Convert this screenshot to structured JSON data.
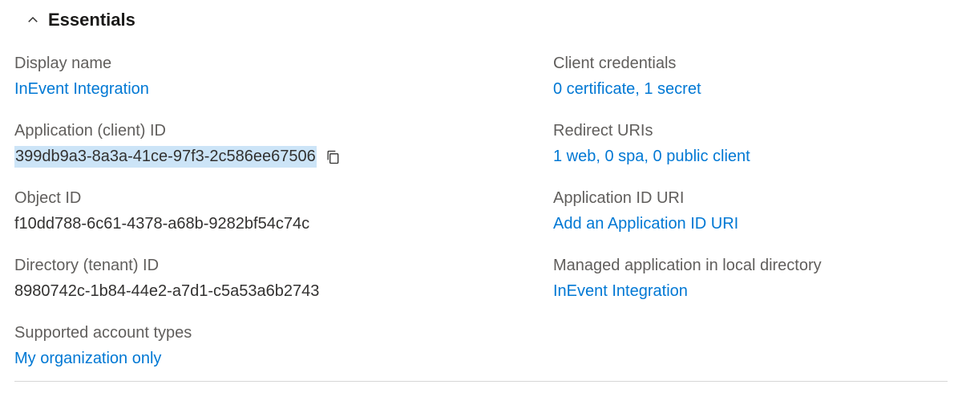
{
  "header": {
    "title": "Essentials"
  },
  "left": {
    "display_name": {
      "label": "Display name",
      "value": "InEvent Integration"
    },
    "application_id": {
      "label": "Application (client) ID",
      "value": "399db9a3-8a3a-41ce-97f3-2c586ee67506"
    },
    "object_id": {
      "label": "Object ID",
      "value": "f10dd788-6c61-4378-a68b-9282bf54c74c"
    },
    "directory_id": {
      "label": "Directory (tenant) ID",
      "value": "8980742c-1b84-44e2-a7d1-c5a53a6b2743"
    },
    "supported_accounts": {
      "label": "Supported account types",
      "value": "My organization only"
    }
  },
  "right": {
    "client_credentials": {
      "label": "Client credentials",
      "value": "0 certificate, 1 secret"
    },
    "redirect_uris": {
      "label": "Redirect URIs",
      "value": "1 web, 0 spa, 0 public client"
    },
    "app_id_uri": {
      "label": "Application ID URI",
      "value": "Add an Application ID URI"
    },
    "managed_app": {
      "label": "Managed application in local directory",
      "value": "InEvent Integration"
    }
  }
}
